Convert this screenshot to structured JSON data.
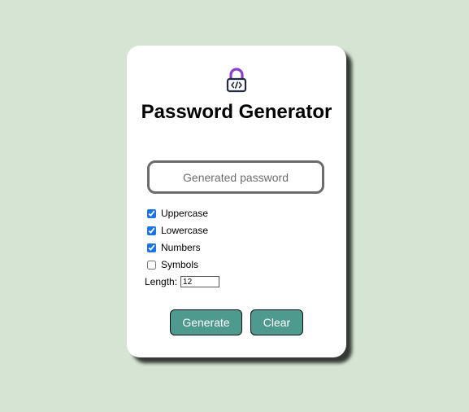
{
  "app": {
    "title": "Password Generator"
  },
  "password_field": {
    "value": "",
    "placeholder": "Generated password"
  },
  "options": [
    {
      "label": "Uppercase",
      "checked": true
    },
    {
      "label": "Lowercase",
      "checked": true
    },
    {
      "label": "Numbers",
      "checked": true
    },
    {
      "label": "Symbols",
      "checked": false
    }
  ],
  "length": {
    "label": "Length:",
    "value": "12"
  },
  "buttons": {
    "generate_label": "Generate",
    "clear_label": "Clear"
  },
  "colors": {
    "background": "#d6e5d3",
    "card": "#ffffff",
    "button": "#4e9a8e",
    "lock_shackle": "#8a3fd1",
    "lock_body": "#1f2a44"
  },
  "icons": {
    "header": "lock-code-icon"
  }
}
